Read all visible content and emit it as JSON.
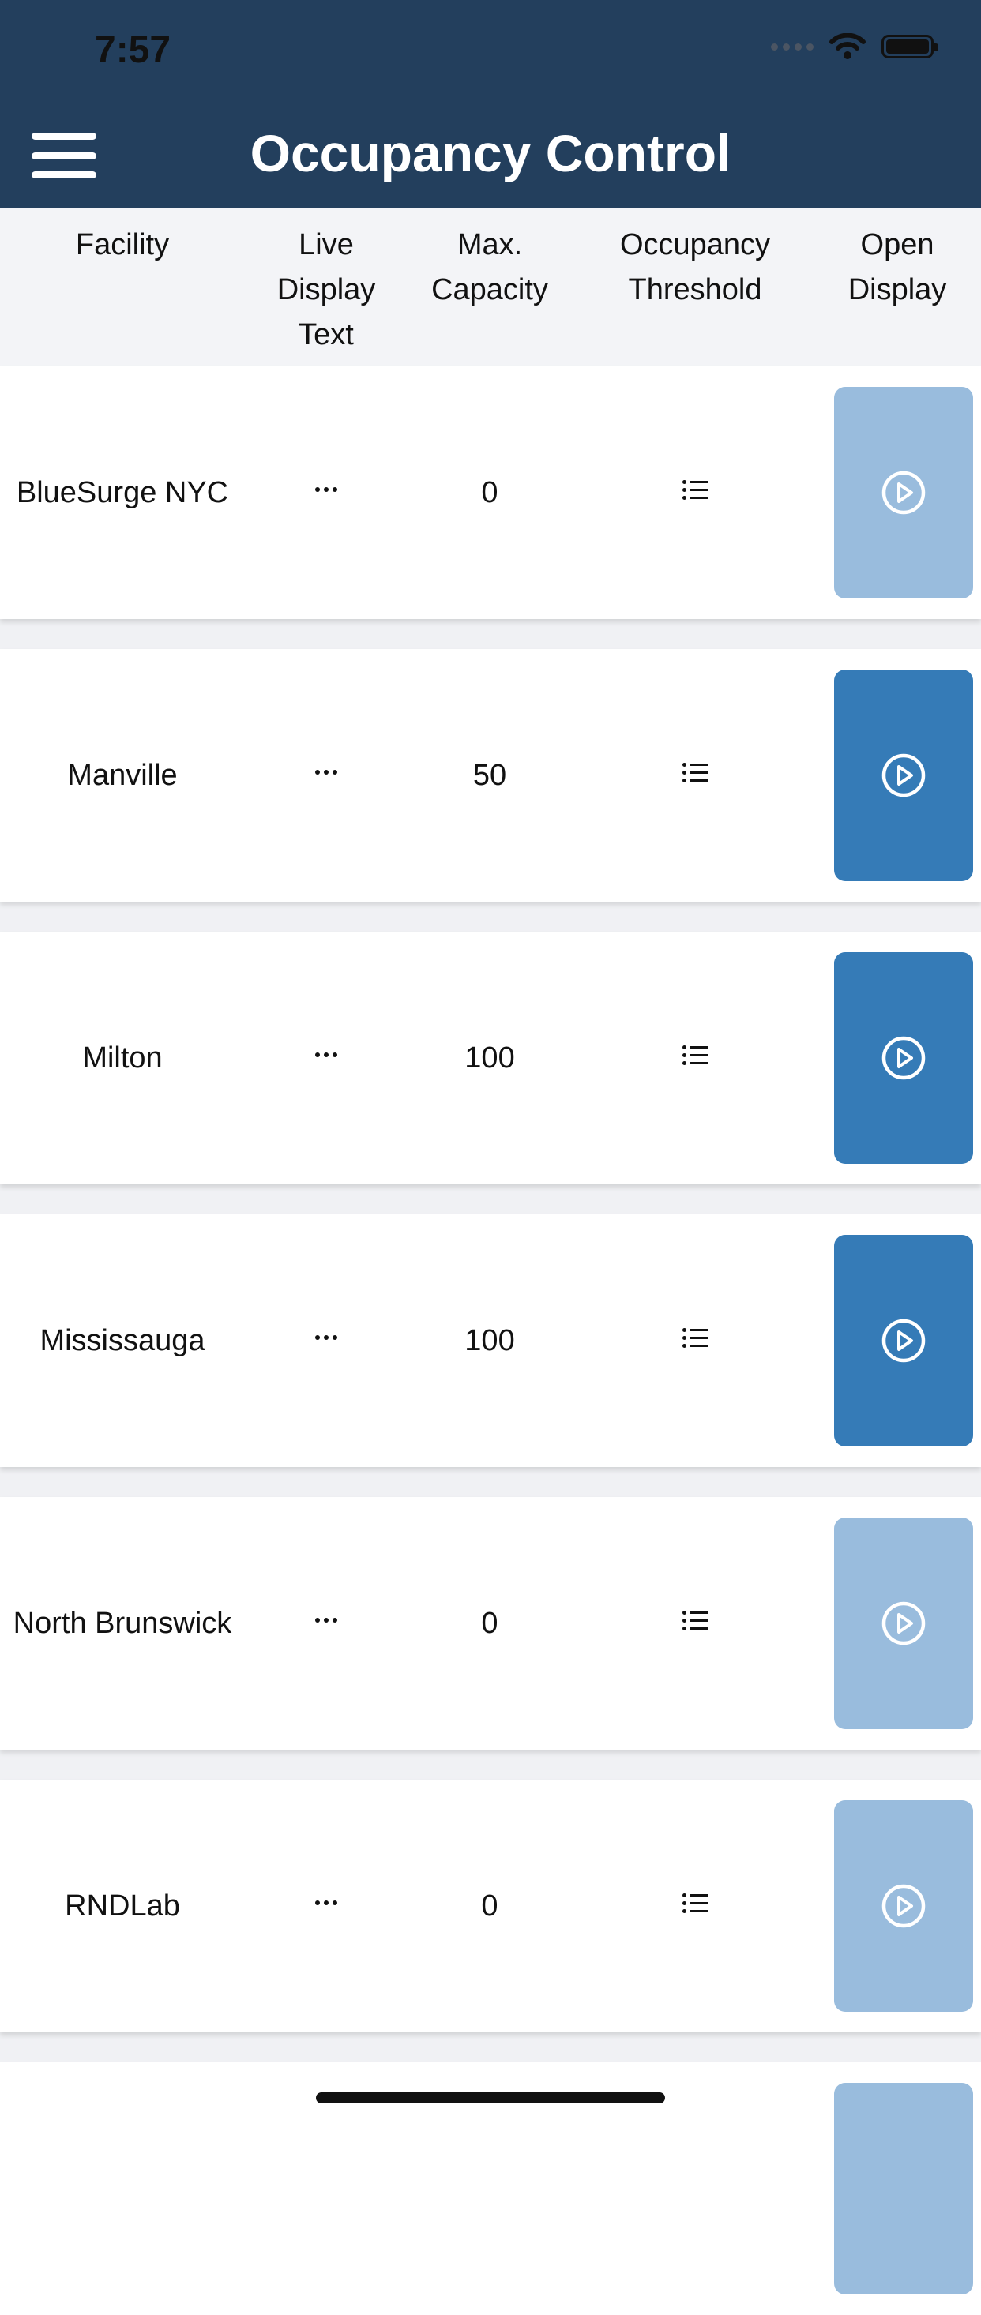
{
  "status_bar": {
    "time": "7:57"
  },
  "header": {
    "title": "Occupancy Control"
  },
  "columns": {
    "facility": "Facility",
    "live_display_text": "Live\nDisplay\nText",
    "max_capacity": "Max.\nCapacity",
    "occupancy_threshold": "Occupancy\nThreshold",
    "open_display": "Open\nDisplay"
  },
  "rows": [
    {
      "facility": "BlueSurge NYC",
      "max_capacity": "0",
      "open_display_enabled": false
    },
    {
      "facility": "Manville",
      "max_capacity": "50",
      "open_display_enabled": true
    },
    {
      "facility": "Milton",
      "max_capacity": "100",
      "open_display_enabled": true
    },
    {
      "facility": "Mississauga",
      "max_capacity": "100",
      "open_display_enabled": true
    },
    {
      "facility": "North Brunswick",
      "max_capacity": "0",
      "open_display_enabled": false
    },
    {
      "facility": "RNDLab",
      "max_capacity": "0",
      "open_display_enabled": false
    }
  ],
  "colors": {
    "header_bg": "#233f5d",
    "button_active": "#357bb7",
    "button_inactive": "#99bcdd"
  },
  "icons": {
    "menu": "hamburger-icon",
    "live_display": "ellipsis-icon",
    "threshold": "list-icon",
    "open_display": "play-circle-icon"
  }
}
